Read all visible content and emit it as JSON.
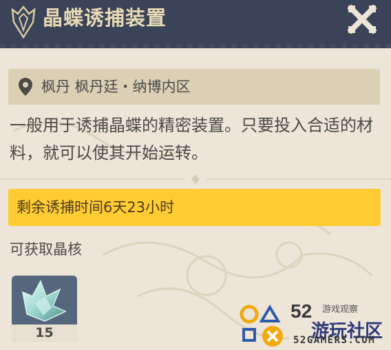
{
  "header": {
    "title": "晶蝶诱捕装置"
  },
  "location": {
    "text": "枫丹 枫丹廷・纳博内区"
  },
  "description": "一般用于诱捕晶蝶的精密装置。只要投入合适的材料，就可以使其开始运转。",
  "timer": {
    "text": "剩余诱捕时间6天23小时"
  },
  "rewards": {
    "label": "可获取晶核",
    "items": [
      {
        "count": "15",
        "icon": "crystal-core-icon"
      }
    ]
  },
  "watermark": {
    "number": "52",
    "subtitle": "游戏观察",
    "name": "游玩社区",
    "url": "52GAMERS.COM"
  },
  "colors": {
    "header": "#3a4358",
    "panel": "#ece5d8",
    "timer": "#ffcc33",
    "title": "#e8d9b5"
  }
}
